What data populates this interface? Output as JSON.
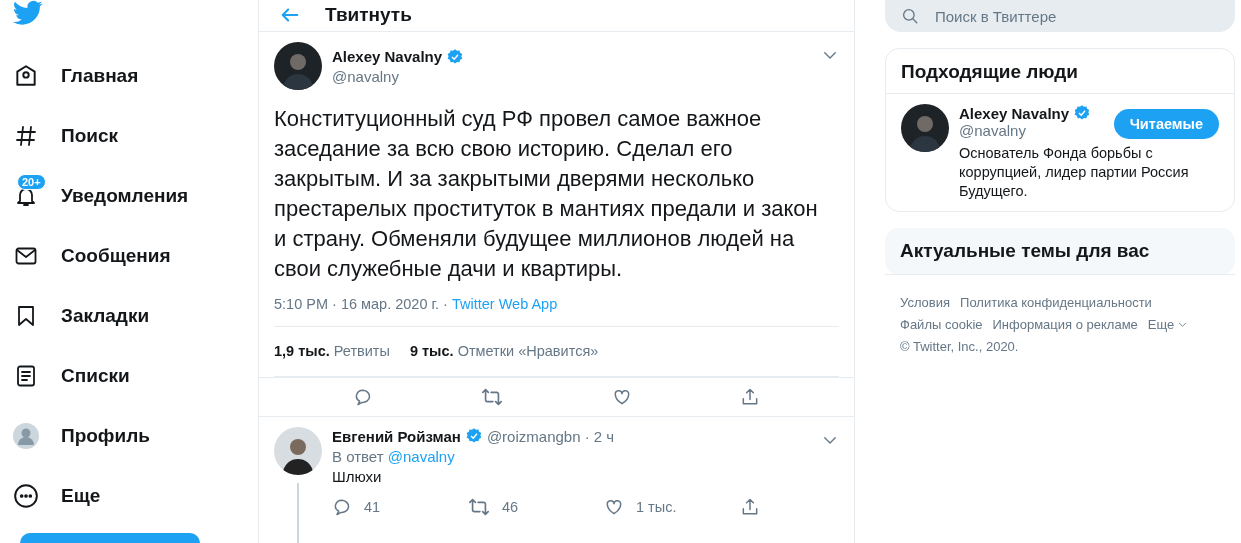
{
  "nav": {
    "items": [
      {
        "kind": "home",
        "label": "Главная"
      },
      {
        "kind": "hash",
        "label": "Поиск"
      },
      {
        "kind": "bell",
        "label": "Уведомления",
        "badge": "20+"
      },
      {
        "kind": "mail",
        "label": "Сообщения"
      },
      {
        "kind": "bookmark",
        "label": "Закладки"
      },
      {
        "kind": "list",
        "label": "Списки"
      },
      {
        "kind": "avatar",
        "label": "Профиль"
      },
      {
        "kind": "more",
        "label": "Еще"
      }
    ]
  },
  "header": {
    "title": "Твитнуть"
  },
  "tweet": {
    "name": "Alexey Navalny",
    "verified": true,
    "handle": "@navalny",
    "text": "Конституционный суд РФ провел самое важное заседание за всю свою историю. Сделал его закрытым. И за закрытыми дверями несколько престарелых проституток в мантиях предали и закон и страну. Обменяли будущее миллионов людей на свои служебные дачи и квартиры.",
    "time": "5:10 PM · 16 мар. 2020 г. · ",
    "source": "Twitter Web App",
    "stats": [
      {
        "count": "1,9 тыс.",
        "label": "Ретвиты"
      },
      {
        "count": "9 тыс.",
        "label": "Отметки «Нравится»"
      }
    ]
  },
  "reply": {
    "name": "Евгений Ройзман",
    "verified": true,
    "handle": "@roizmangbn · 2 ч",
    "in_reply": "В ответ ",
    "mention": "@navalny",
    "text": "Шлюхи",
    "counts": {
      "reply": "41",
      "retweet": "46",
      "like": "1 тыс."
    }
  },
  "search": {
    "placeholder": "Поиск в Твиттере"
  },
  "who_to_follow": {
    "title": "Подходящие люди",
    "people": [
      {
        "name": "Alexey Navalny",
        "verified": true,
        "handle": "@navalny",
        "button": "Читаемые",
        "bio": "Основатель Фонда борьбы с коррупцией, лидер партии Россия Будущего."
      }
    ]
  },
  "trends": {
    "title": "Актуальные темы для вас"
  },
  "footer": {
    "links": [
      "Условия",
      "Политика конфиденциальности",
      "Файлы cookie",
      "Информация о рекламе",
      "Еще"
    ],
    "copyright": "© Twitter, Inc., 2020."
  }
}
